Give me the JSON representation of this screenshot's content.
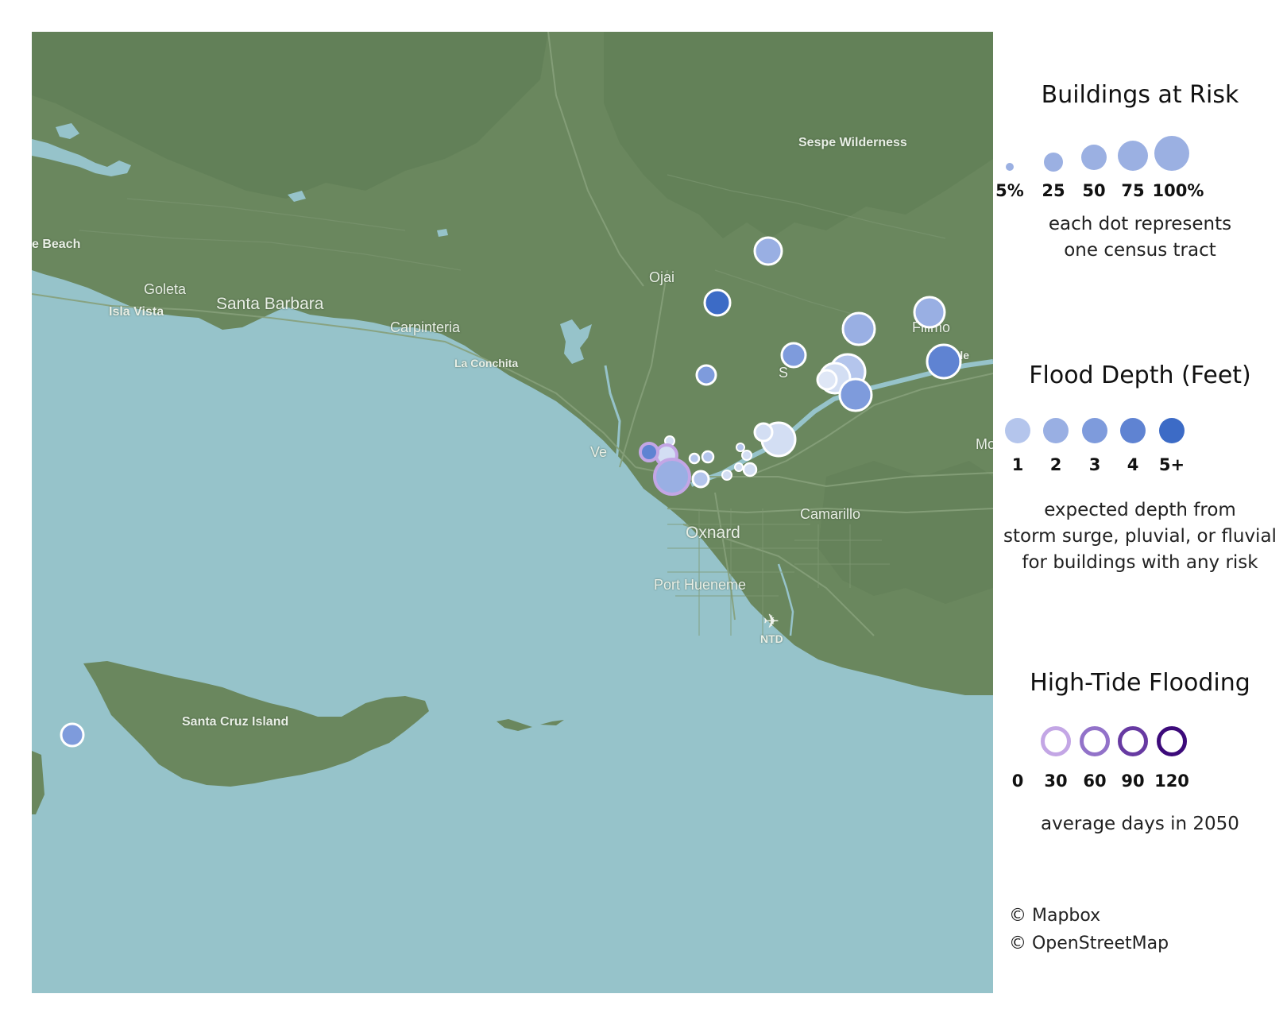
{
  "map": {
    "place_labels": [
      {
        "id": "sespe",
        "text": "Sespe Wilderness"
      },
      {
        "id": "beach",
        "text": "e Beach"
      },
      {
        "id": "goleta",
        "text": "Goleta"
      },
      {
        "id": "isla-vista",
        "text": "Isla Vista"
      },
      {
        "id": "santa-barbara",
        "text": "Santa Barbara"
      },
      {
        "id": "carpinteria",
        "text": "Carpinteria"
      },
      {
        "id": "la-conchita",
        "text": "La Conchita"
      },
      {
        "id": "ojai",
        "text": "Ojai"
      },
      {
        "id": "fillmore",
        "text": "Fillmo"
      },
      {
        "id": "dale",
        "text": "dale"
      },
      {
        "id": "santa-paula-a",
        "text": "S"
      },
      {
        "id": "santa-paula-b",
        "text": "ula"
      },
      {
        "id": "ventura",
        "text": "Ve"
      },
      {
        "id": "moorpark",
        "text": "Mo"
      },
      {
        "id": "oxnard",
        "text": "Oxnard"
      },
      {
        "id": "camarillo",
        "text": "Camarillo"
      },
      {
        "id": "port-hueneme",
        "text": "Port Hueneme"
      },
      {
        "id": "ntd",
        "text": "NTD"
      },
      {
        "id": "santa-cruz-island",
        "text": "Santa Cruz Island"
      }
    ],
    "airport_icon": "airplane-icon",
    "colors": {
      "ocean": "#96c3ca",
      "land": "#6a875e",
      "land_dark": "#5c7a51",
      "road": "#7f9873"
    }
  },
  "legend": {
    "buildings": {
      "title": "Buildings at Risk",
      "ticks": [
        "5%",
        "25",
        "50",
        "75",
        "100%"
      ],
      "sizes_pct": [
        5,
        25,
        50,
        75,
        100
      ],
      "caption": [
        "each dot represents",
        "one census tract"
      ],
      "color": "#9bb0e2"
    },
    "depth": {
      "title": "Flood Depth (Feet)",
      "ticks": [
        "1",
        "2",
        "3",
        "4",
        "5+"
      ],
      "colors": [
        "#b4c5ec",
        "#99afe3",
        "#7e9bdc",
        "#5f83d2",
        "#3c6bc6"
      ],
      "caption": [
        "expected depth from",
        "storm surge, pluvial, or fluvial",
        "for buildings with any risk"
      ]
    },
    "tide": {
      "title": "High-Tide Flooding",
      "ticks": [
        "0",
        "30",
        "60",
        "90",
        "120"
      ],
      "colors": [
        "#ffffff",
        "#c3a6e5",
        "#9272c9",
        "#673aa2",
        "#3c0a7a"
      ],
      "caption": [
        "average days in 2050"
      ]
    }
  },
  "credits": [
    "© Mapbox",
    "© OpenStreetMap"
  ]
}
